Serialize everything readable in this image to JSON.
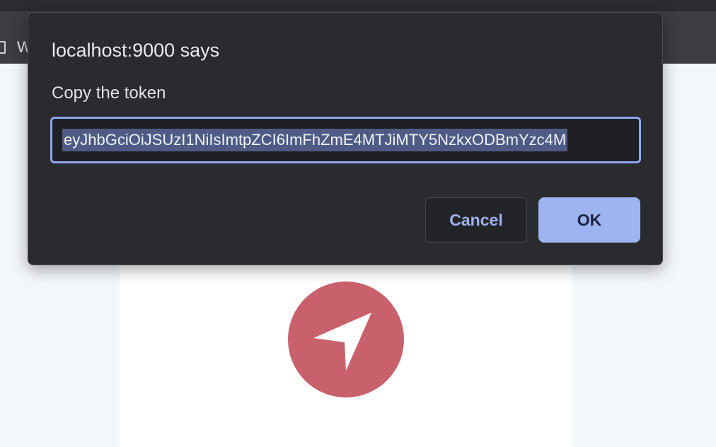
{
  "browser": {
    "tab_letter": "W"
  },
  "dialog": {
    "title": "localhost:9000 says",
    "message": "Copy the token",
    "input_value": "eyJhbGciOiJSUzI1NiIsImtpZCI6ImFhZmE4MTJiMTY5NzkxODBmYzc4M",
    "cancel_label": "Cancel",
    "ok_label": "OK"
  },
  "colors": {
    "dialog_bg": "#2a2b2f",
    "accent": "#9fb3f0",
    "logo": "#c9616c"
  },
  "icons": {
    "logo": "navigation-arrow-icon",
    "tab": "tab-page-icon"
  }
}
